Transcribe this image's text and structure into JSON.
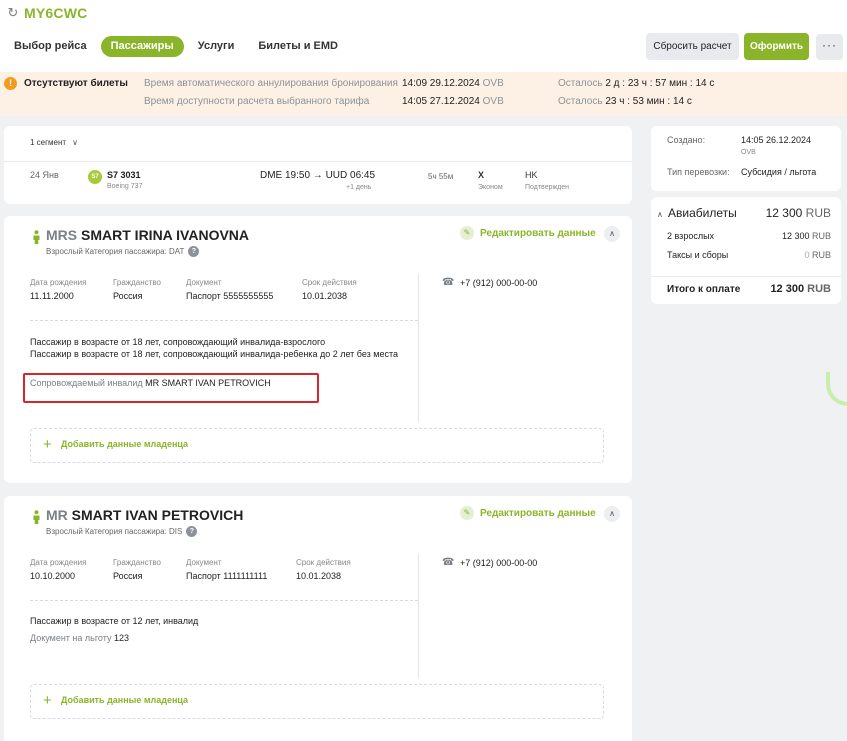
{
  "header": {
    "pnr": "MY6CWC",
    "tabs": [
      {
        "label": "Выбор рейса",
        "active": false
      },
      {
        "label": "Пассажиры",
        "active": true
      },
      {
        "label": "Услуги",
        "active": false
      },
      {
        "label": "Билеты и EMD",
        "active": false
      }
    ],
    "reset_label": "Сбросить расчет",
    "issue_label": "Оформить",
    "more_label": "···"
  },
  "warning": {
    "icon": "!",
    "title": "Отсутствуют билеты",
    "rows": [
      {
        "label": "Время автоматического аннулирования бронирования",
        "time": "14:09 29.12.2024",
        "city": "OVB",
        "remaining_label": "Осталось",
        "remaining": "2 д : 23 ч : 57 мин : 14 с"
      },
      {
        "label": "Время доступности расчета выбранного тарифа",
        "time": "14:05 27.12.2024",
        "city": "OVB",
        "remaining_label": "Осталось",
        "remaining": "23 ч : 53 мин : 14 с"
      }
    ]
  },
  "segment": {
    "toggle_label": "1 сегмент",
    "date": "24 Янв",
    "airline_logo": "S7",
    "flight": "S7 3031",
    "aircraft": "Boeing 737",
    "route": "DME 19:50 → UUD 06:45",
    "next_day": "+1 день",
    "duration": "5ч 55м",
    "class_code": "X",
    "class_name": "Эконом",
    "status_code": "HK",
    "status_name": "Подтвержден"
  },
  "info": {
    "created_label": "Создано:",
    "created_value": "14:05 26.12.2024",
    "created_city": "OVB",
    "type_label": "Тип перевозки:",
    "type_value": "Субсидия / льгота"
  },
  "price": {
    "title": "Авиабилеты",
    "total_amount": "12 300",
    "currency": "RUB",
    "rows": [
      {
        "label": "2 взрослых",
        "amount": "12 300"
      },
      {
        "label": "Таксы и сборы",
        "amount": "0"
      }
    ],
    "final_label": "Итого к оплате",
    "final_amount": "12 300"
  },
  "passengers": [
    {
      "title": "MRS",
      "name": "SMART IRINA IVANOVNA",
      "subtitle": "Взрослый  Категория пассажира: DAT",
      "edit_label": "Редактировать данные",
      "fields": [
        {
          "label": "Дата рождения",
          "value": "11.11.2000"
        },
        {
          "label": "Гражданство",
          "value": "Россия"
        },
        {
          "label": "Документ",
          "value": "Паспорт 5555555555"
        },
        {
          "label": "Срок действия",
          "value": "10.01.2038"
        }
      ],
      "phone": "+7 (912) 000-00-00",
      "notes": [
        "Пассажир в возрасте от 18 лет, сопровождающий инвалида-взрослого",
        "Пассажир в возрасте от 18 лет, сопровождающий инвалида-ребенка до 2 лет без места"
      ],
      "extra_label": "Сопровождаемый инвалид",
      "extra_value": "MR SMART IVAN PETROVICH",
      "add_infant_label": "Добавить данные младенца"
    },
    {
      "title": "MR",
      "name": "SMART IVAN PETROVICH",
      "subtitle": "Взрослый  Категория пассажира: DIS",
      "edit_label": "Редактировать данные",
      "fields": [
        {
          "label": "Дата рождения",
          "value": "10.10.2000"
        },
        {
          "label": "Гражданство",
          "value": "Россия"
        },
        {
          "label": "Документ",
          "value": "Паспорт 1111111111"
        },
        {
          "label": "Срок действия",
          "value": "10.01.2038"
        }
      ],
      "phone": "+7 (912) 000-00-00",
      "notes": [
        "Пассажир в возрасте от 12 лет, инвалид"
      ],
      "extra_label": "Документ на льготу",
      "extra_value": "123",
      "add_infant_label": "Добавить данные младенца"
    }
  ],
  "colors": {
    "accent": "#8ab52a",
    "warning_bg": "#fdf1e6",
    "warning_icon": "#f29b1d",
    "highlight": "#d3282b"
  }
}
